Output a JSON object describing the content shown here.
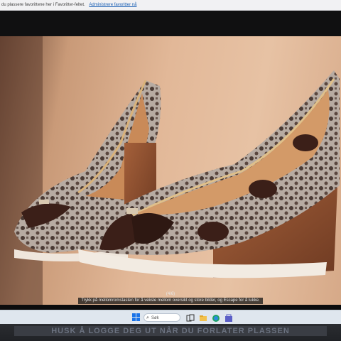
{
  "favorites_bar": {
    "message": "du plassere favorittene her i Favoritter-feltet.",
    "manage_link": "Administrere favoritter nå"
  },
  "viewer": {
    "counter": "(4/6)",
    "hint": "Trykk på mellomromstasten for å veksle mellom oversikt og store bilder, og Escape for å lukke."
  },
  "taskbar": {
    "search_placeholder": "Søk",
    "icons": [
      "windows-start-icon",
      "search-icon",
      "task-view-icon",
      "file-explorer-icon",
      "edge-icon",
      "store-icon"
    ]
  },
  "sticker": {
    "text": "HUSK Å LOGGE DEG UT NÅR DU FORLATER PLASSEN"
  },
  "colors": {
    "wall_light": "#e7c2a4",
    "shoe_wood": "#8a4a2a",
    "shoe_fabric": "#b8aca4",
    "ribbon": "#3b1f18",
    "accent_link": "#1a5fb4"
  }
}
